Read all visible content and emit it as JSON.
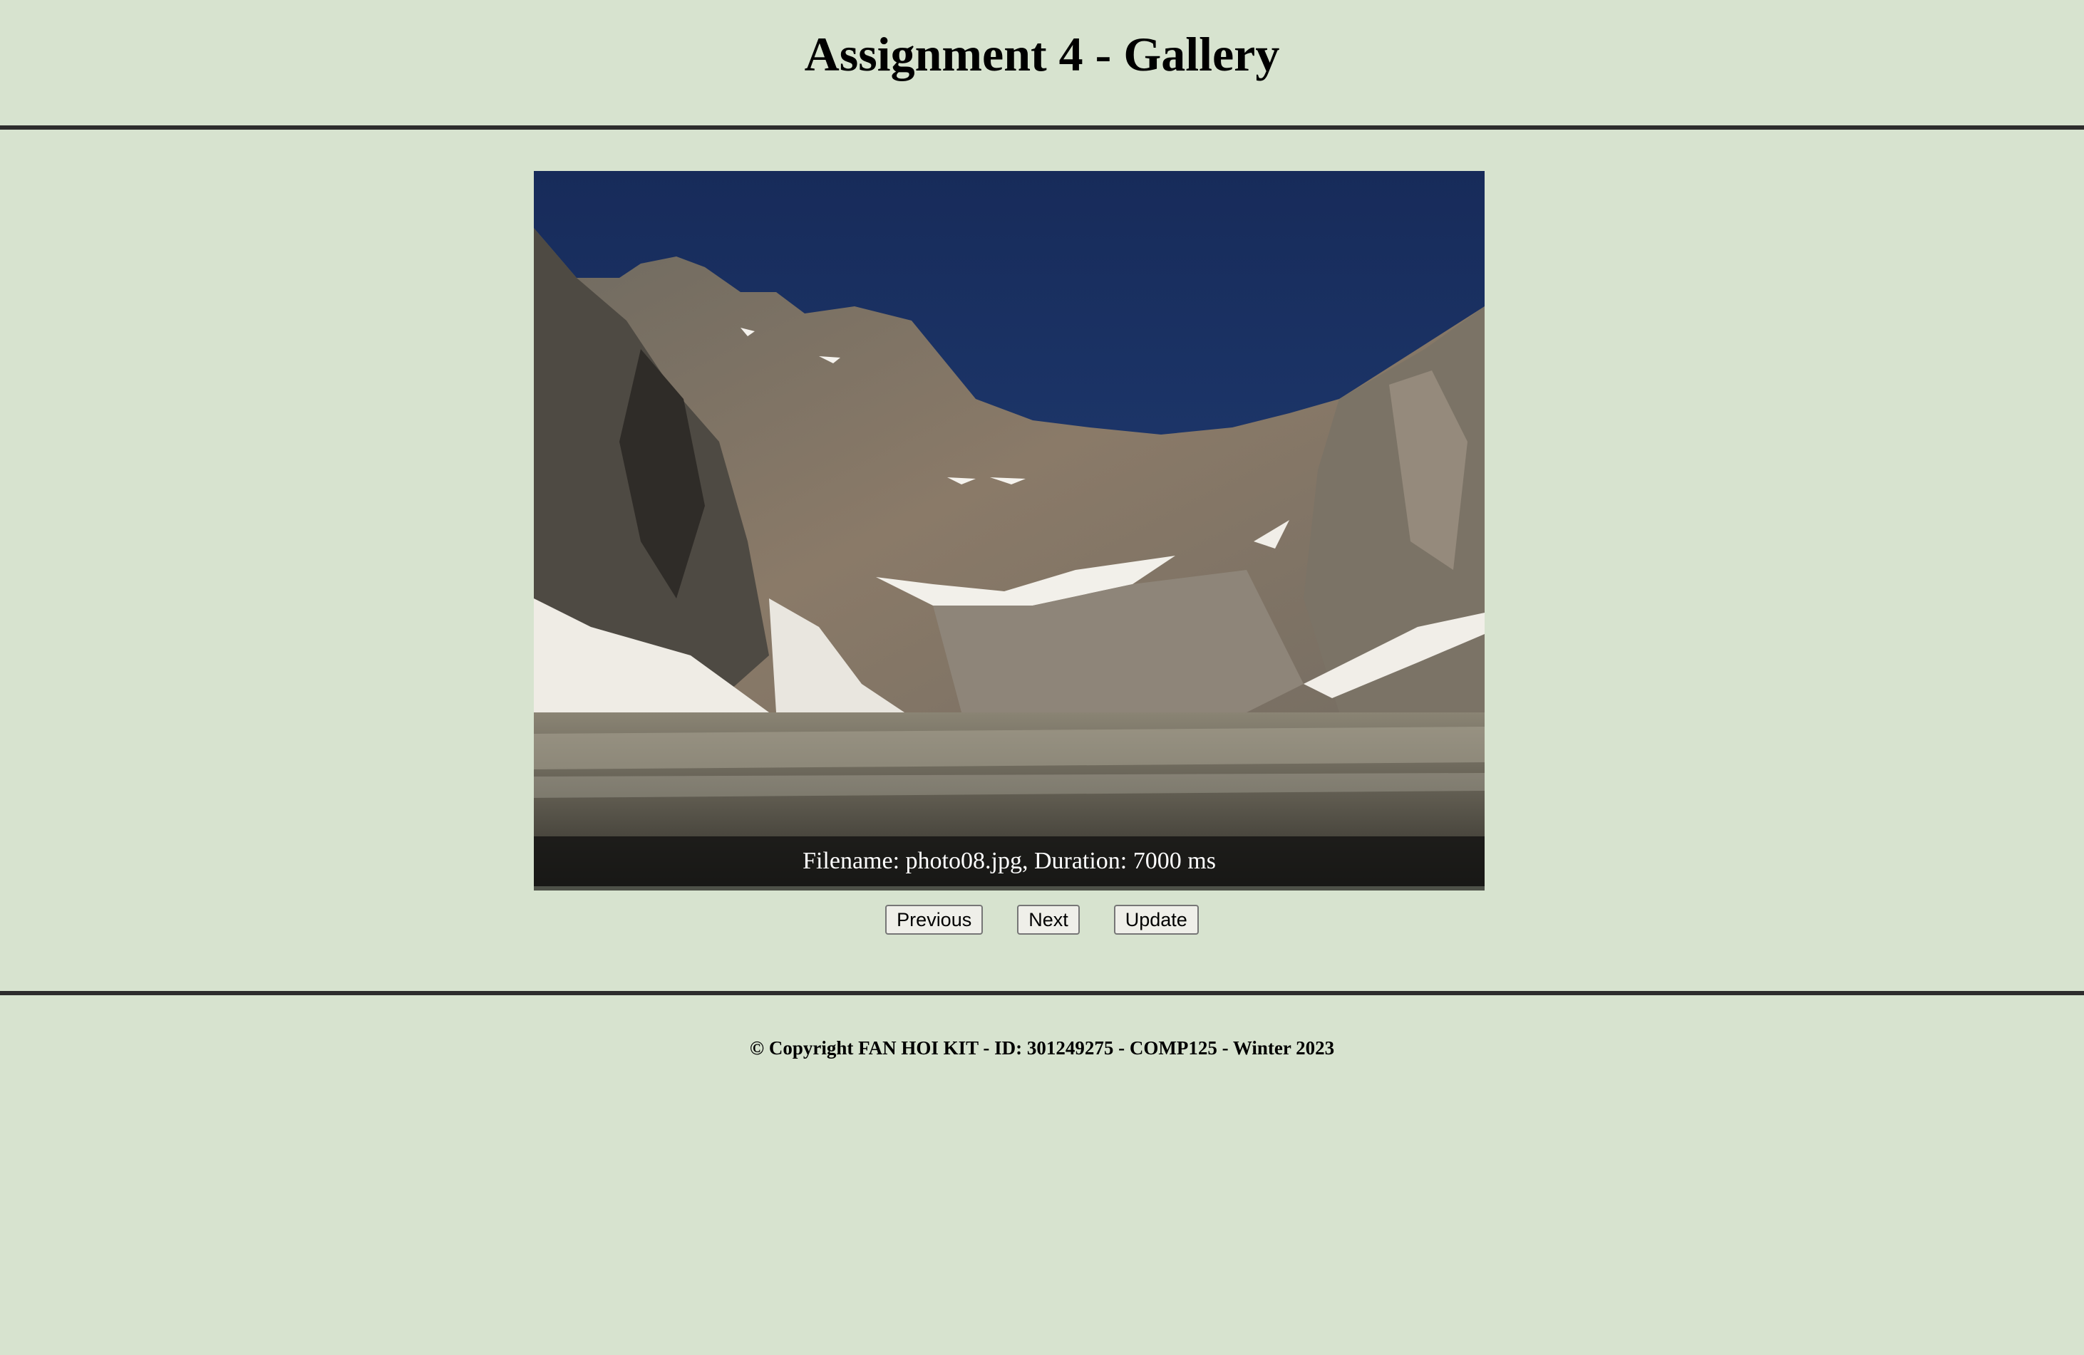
{
  "header": {
    "title": "Assignment 4 - Gallery"
  },
  "gallery": {
    "image_description_icon": "mountain-lake-photo",
    "caption": "Filename: photo08.jpg, Duration: 7000 ms"
  },
  "controls": {
    "previous_label": "Previous",
    "next_label": "Next",
    "update_label": "Update"
  },
  "footer": {
    "copyright": "© Copyright FAN HOI KIT - ID: 301249275 - COMP125 - Winter 2023"
  },
  "colors": {
    "background": "#d7e3cf",
    "rule": "#2d2d2d",
    "caption_bg": "#141412"
  }
}
